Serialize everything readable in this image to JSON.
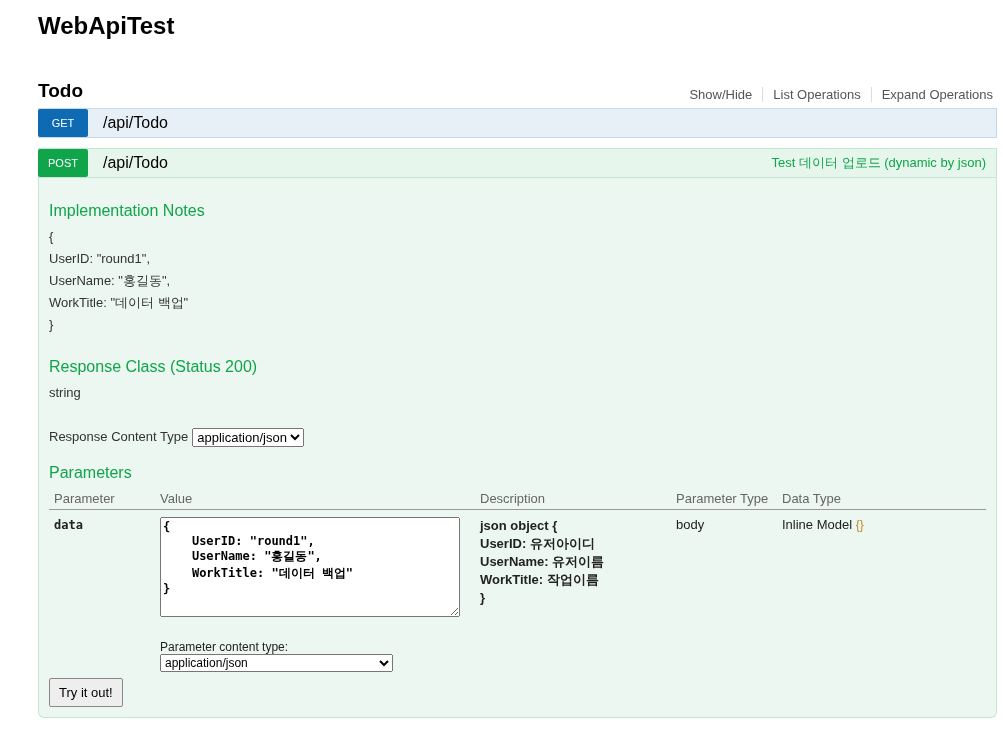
{
  "title": "WebApiTest",
  "resource": {
    "name": "Todo",
    "actions": [
      "Show/Hide",
      "List Operations",
      "Expand Operations"
    ]
  },
  "operations": [
    {
      "method": "GET",
      "kind": "get",
      "path": "/api/Todo",
      "expanded": false
    },
    {
      "method": "POST",
      "kind": "post",
      "path": "/api/Todo",
      "summary": "Test 데이터 업로드 (dynamic by json)",
      "expanded": true,
      "notes_title": "Implementation Notes",
      "notes": [
        "{",
        "UserID: \"round1\",",
        "UserName: \"홍길동\",",
        "WorkTitle: \"데이터 백업\"",
        "}"
      ],
      "response_title": "Response Class (Status 200)",
      "response_type": "string",
      "content_type_label": "Response Content Type",
      "content_type": "application/json",
      "params_title": "Parameters",
      "columns": [
        "Parameter",
        "Value",
        "Description",
        "Parameter Type",
        "Data Type"
      ],
      "params": [
        {
          "name": "data",
          "value": "{\n    UserID: \"round1\",\n    UserName: \"홍길동\",\n    WorkTitle: \"데이터 백업\"\n}",
          "description": [
            "json object {",
            "UserID: 유저아이디",
            "UserName: 유저이름",
            "WorkTitle: 작업이름",
            "}"
          ],
          "param_type": "body",
          "data_type": "Inline Model",
          "model_link": "{}",
          "param_content_label": "Parameter content type:",
          "param_content_type": "application/json"
        }
      ],
      "submit": "Try it out!"
    }
  ]
}
